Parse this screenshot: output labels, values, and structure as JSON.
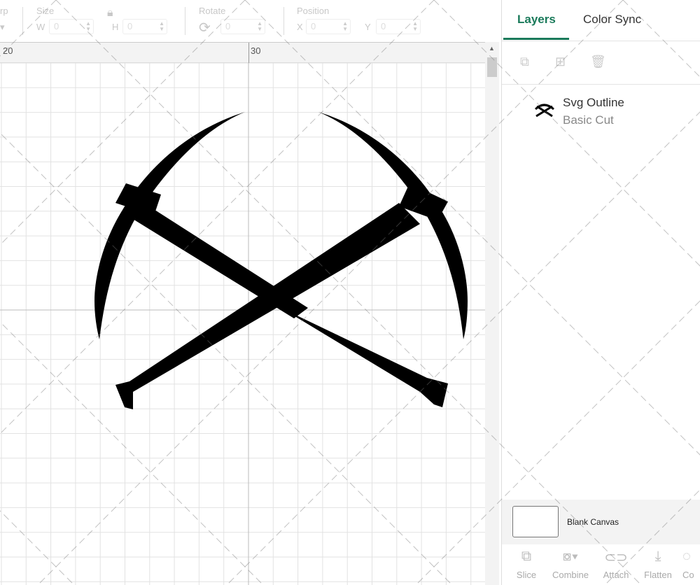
{
  "toolbar": {
    "cut_label": "rp",
    "size_label": "Size",
    "w_letter": "W",
    "w_value": "0",
    "h_letter": "H",
    "h_value": "0",
    "rotate_label": "Rotate",
    "rotate_value": "0",
    "position_label": "Position",
    "x_letter": "X",
    "x_value": "0",
    "y_letter": "Y",
    "y_value": "0"
  },
  "ruler": {
    "ticks": [
      "20",
      "30"
    ]
  },
  "panel": {
    "tabs": [
      {
        "label": "Layers",
        "active": true
      },
      {
        "label": "Color Sync",
        "active": false
      }
    ],
    "layer": {
      "name": "Svg Outline",
      "type": "Basic Cut"
    },
    "blank_canvas": "Blank Canvas",
    "actions": [
      {
        "label": "Slice",
        "icon": "slice-icon"
      },
      {
        "label": "Combine",
        "icon": "combine-icon"
      },
      {
        "label": "Attach",
        "icon": "attach-icon"
      },
      {
        "label": "Flatten",
        "icon": "flatten-icon"
      },
      {
        "label": "Co",
        "icon": "contour-icon"
      }
    ]
  },
  "colors": {
    "accent": "#1a7a5a",
    "shape": "#000000"
  }
}
